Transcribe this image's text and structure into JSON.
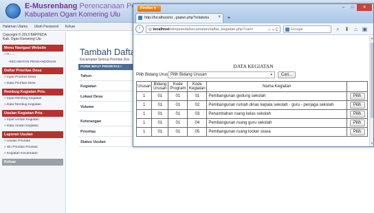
{
  "app": {
    "title_main": "E-Musrenbang",
    "title_suffix": "Perencanaan Pembangunan",
    "subtitle": "Kabupaten Ogan Komering Ulu"
  },
  "nav": {
    "items": [
      "Halaman Utama",
      "Ubah Password",
      "Keluar"
    ]
  },
  "sidebar": {
    "copyright_line1": "Copyright © 2013 BAPPEDA",
    "copyright_line2": "Kab. Ogan Komering Ulu",
    "sections": [
      {
        "heading": "Menu Navigasi Website",
        "items": [
          "» H......",
          "KECAMATAN PENGANDONAN"
        ]
      },
      {
        "heading": "Daftar Prioritas Desa",
        "items": [
          "» Input Prioritas Desa",
          "» Data Prioritas Desa"
        ]
      },
      {
        "heading": "Rembug Kegiatan Prio.",
        "items": [
          "» Input Rembug Kegiatan",
          "» Data Rembug Kegiatan"
        ]
      },
      {
        "heading": "Usulan Kegiatan Prio.",
        "items": [
          "» Input Urutan Kegiatan",
          "» Data Urutan Kegiatan"
        ]
      },
      {
        "heading": "Laporan Usulan",
        "items": [
          "» Usulan Prioritas",
          "» Sin Prioritas Prioritas",
          "» Kegiatan Kecamatan"
        ]
      },
      {
        "heading": "Keluar",
        "items": []
      }
    ]
  },
  "main": {
    "title": "Tambah Dafta",
    "subtitle": "Kecamatan Semua Prioritas Des",
    "form_bar": "FORM INPUT PRIORITAS I",
    "fields": [
      "Tahun",
      "Kegiatan",
      "Lokasi Desa",
      "Volume",
      "Keterangan",
      "Prioritas",
      "Status Usulan"
    ]
  },
  "popup": {
    "browser_button": "Firefox",
    "tab_title": "http://localhost/si...giatan.php?nilaiteks",
    "url_host": "localhost",
    "url_path": "/simpeseda/kecamatan/daftar_kegiatan.php?cari=",
    "search_placeholder": "Google",
    "heading": "DATA KEGIATAN",
    "filter_label": "Pilih Bidang Urusan",
    "filter_value": "Pilih Bidang Urusan",
    "cari_label": "Cari...",
    "table": {
      "headers": [
        "Urusan",
        "Bidang Urusan",
        "Kode Program",
        "Kode Kegiatan",
        "Nama Kegiatan",
        ""
      ],
      "rows": [
        {
          "urusan": "1",
          "bidang": "01",
          "program": "01",
          "kegiatan": "01",
          "nama": "Pembangunan gedung sekolah",
          "action": "Pilih"
        },
        {
          "urusan": "1",
          "bidang": "01",
          "program": "01",
          "kegiatan": "02",
          "nama": "Pembangunan rumah dinas kepala sekolah - guru - penjaga sekolah",
          "action": "Pilih"
        },
        {
          "urusan": "1",
          "bidang": "01",
          "program": "01",
          "kegiatan": "03",
          "nama": "Penambahan ruang kelas sekolah",
          "action": "Pilih"
        },
        {
          "urusan": "1",
          "bidang": "01",
          "program": "01",
          "kegiatan": "04",
          "nama": "Pembangunan ruang guru sekolah",
          "action": "Pilih"
        },
        {
          "urusan": "1",
          "bidang": "01",
          "program": "01",
          "kegiatan": "05",
          "nama": "Pembangunan ruang locker siswa",
          "action": "Pilih"
        }
      ]
    }
  },
  "colors": {
    "brand_purple": "#7a2f9a",
    "sidebar_heading": "#b6312f",
    "firefox_orange": "#e26a0c"
  }
}
